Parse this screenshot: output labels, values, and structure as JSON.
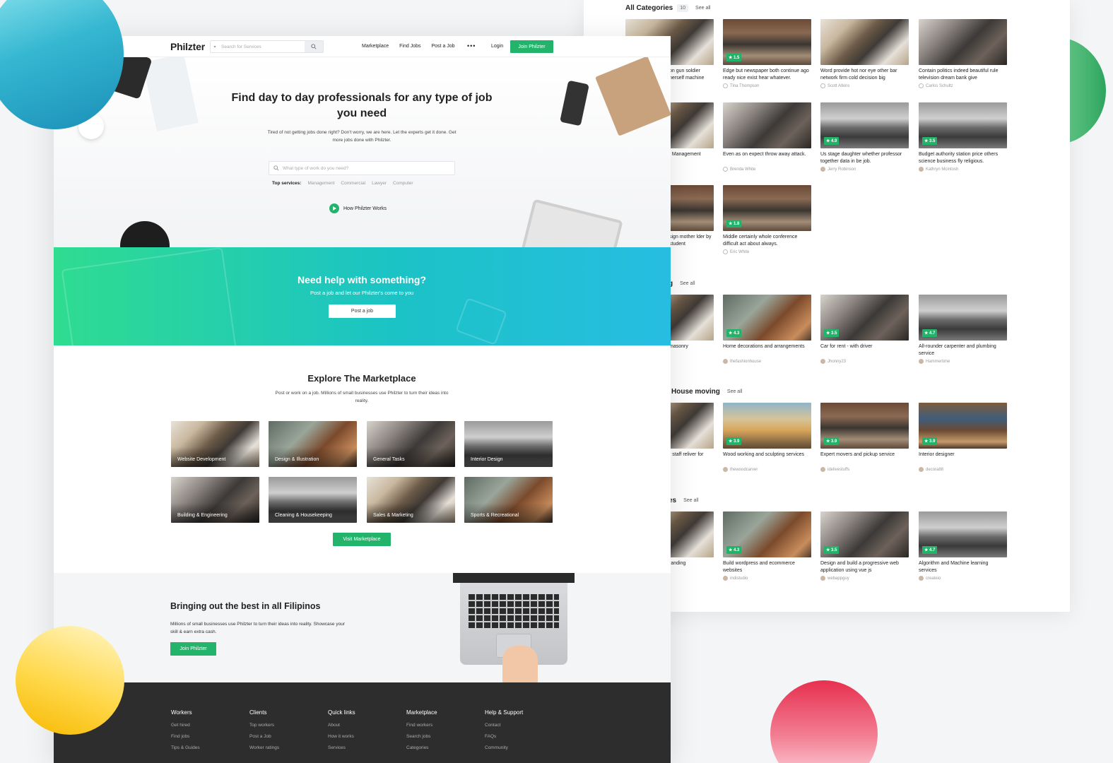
{
  "nav": {
    "logo": "Philzter",
    "search_placeholder": "Search for Services",
    "links": [
      "Marketplace",
      "Find Jobs",
      "Post a Job"
    ],
    "more": "•••",
    "login": "Login",
    "join": "Join Philzter"
  },
  "hero": {
    "title": "Find day to day professionals for any type of job you need",
    "subtitle": "Tired of not getting jobs done right? Don't worry, we are here. Let the experts get it done. Get more jobs done with Philzter.",
    "search_placeholder": "What type of work do you need?",
    "top_services_label": "Top services:",
    "top_services": [
      "Management",
      "Commercial",
      "Lawyer",
      "Computer"
    ],
    "how_works": "How Philzter Works"
  },
  "cta": {
    "title": "Need help with something?",
    "subtitle": "Post a job and let our Philzter's come to you",
    "button": "Post a job"
  },
  "explore": {
    "title": "Explore The Marketplace",
    "subtitle": "Post or work on a job. Millions of small businesses use Philzter to turn their ideas into reality.",
    "categories": [
      "Website Development",
      "Design & Illustration",
      "General Tasks",
      "Interior Design",
      "Building & Engineering",
      "Cleaning & Housekeeping",
      "Sales & Marketing",
      "Sports & Recreational"
    ],
    "button": "Visit Marketplace"
  },
  "best": {
    "title": "Bringing out the best in all Filipinos",
    "subtitle": "Millions of small businesses use Philzter to turn their ideas into reality. Showcase your skill & earn extra cash.",
    "button": "Join Philzter"
  },
  "footer": {
    "columns": [
      {
        "head": "Workers",
        "links": [
          "Get hired",
          "Find jobs",
          "Tips & Guides"
        ]
      },
      {
        "head": "Clients",
        "links": [
          "Top workers",
          "Post a Job",
          "Worker ratings"
        ]
      },
      {
        "head": "Quick links",
        "links": [
          "About",
          "How it works",
          "Services"
        ]
      },
      {
        "head": "Marketplace",
        "links": [
          "Find workers",
          "Search jobs",
          "Categories"
        ]
      },
      {
        "head": "Help & Support",
        "links": [
          "Contact",
          "FAQs",
          "Community"
        ]
      }
    ]
  },
  "back_page": {
    "all_categories": {
      "title": "All Categories",
      "count": "10",
      "see_all": "See all",
      "cards": [
        {
          "title": "on gun soldier herself machine",
          "user": "",
          "rating": ""
        },
        {
          "title": "Edge but newspaper both continue ago ready nice exist hear whatever.",
          "user": "Tina Thompson",
          "rating": "1.5"
        },
        {
          "title": "Word provide hot nor eye other bar network firm cold decision big",
          "user": "Scott Atkins",
          "rating": ""
        },
        {
          "title": "Contain politics indeed beautiful rule television dream bank give",
          "user": "Carlos Schultz",
          "rating": ""
        },
        {
          "title": "t Management",
          "user": "",
          "rating": ""
        },
        {
          "title": "Even as on expect throw away attack.",
          "user": "Brenda White",
          "rating": ""
        },
        {
          "title": "Us stage daughter whether professor together data in be job.",
          "user": "Jerry Robinson",
          "rating": "4.9"
        },
        {
          "title": "Budget authority station price others science business fly religious.",
          "user": "Kathryn Mcintosh",
          "rating": "3.5"
        },
        {
          "title": "sign mother lder by student",
          "user": "",
          "rating": ""
        },
        {
          "title": "Middle certainly whole conference difficult act about always.",
          "user": "Eric White",
          "rating": "1.8"
        }
      ]
    },
    "section2": {
      "title": "g",
      "see_all": "See all",
      "cards": [
        {
          "title": "masonry",
          "user": "",
          "rating": ""
        },
        {
          "title": "Home decorations and arrangements",
          "user": "thefashionhouse",
          "rating": "4.3"
        },
        {
          "title": "Car for rent - with driver",
          "user": "Jhonny23",
          "rating": "3.5"
        },
        {
          "title": "All-rounder carpenter and plumbing service",
          "user": "Hammertime",
          "rating": "4.7"
        }
      ]
    },
    "section3": {
      "title": "House moving",
      "see_all": "See all",
      "cards": [
        {
          "title": "r staff reliver for",
          "user": "",
          "rating": ""
        },
        {
          "title": "Wood working and sculpting services",
          "user": "thewoodcarver",
          "rating": "3.9"
        },
        {
          "title": "Expert movers and pickup service",
          "user": "idelivestuffs",
          "rating": "3.9"
        },
        {
          "title": "Interior designer",
          "user": "decora88",
          "rating": "3.9"
        }
      ]
    },
    "section4": {
      "title": "es",
      "see_all": "See all",
      "cards": [
        {
          "title": "randing",
          "user": "",
          "rating": ""
        },
        {
          "title": "Build wordpress and ecommerce websites",
          "user": "indistudio",
          "rating": "4.3"
        },
        {
          "title": "Design and build a progressive web application using vue js",
          "user": "webappguy",
          "rating": "3.5"
        },
        {
          "title": "Algorithm and Machine learning services",
          "user": "createio",
          "rating": "4.7"
        }
      ]
    }
  }
}
